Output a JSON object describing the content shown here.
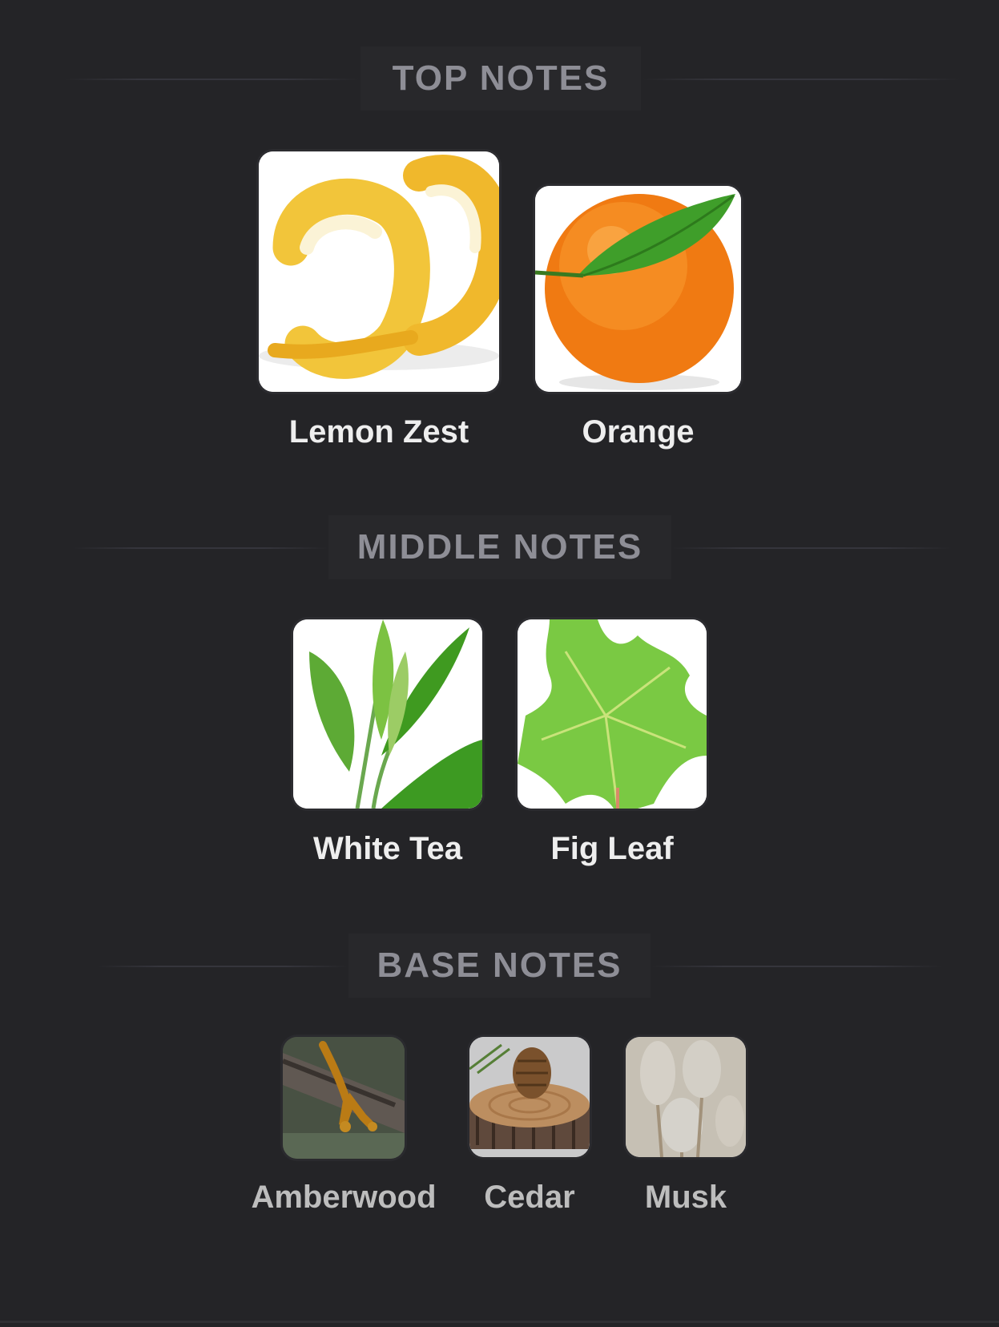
{
  "sections": [
    {
      "title": "TOP NOTES",
      "notes": [
        {
          "label": "Lemon Zest",
          "icon": "lemon-zest-image"
        },
        {
          "label": "Orange",
          "icon": "orange-image"
        }
      ]
    },
    {
      "title": "MIDDLE NOTES",
      "notes": [
        {
          "label": "White Tea",
          "icon": "white-tea-image"
        },
        {
          "label": "Fig Leaf",
          "icon": "fig-leaf-image"
        }
      ]
    },
    {
      "title": "BASE NOTES",
      "notes": [
        {
          "label": "Amberwood",
          "icon": "amberwood-image"
        },
        {
          "label": "Cedar",
          "icon": "cedar-image"
        },
        {
          "label": "Musk",
          "icon": "musk-image"
        }
      ]
    }
  ],
  "colors": {
    "background": "#242427",
    "heading": "#8e8e96",
    "label": "#eeeeee"
  }
}
